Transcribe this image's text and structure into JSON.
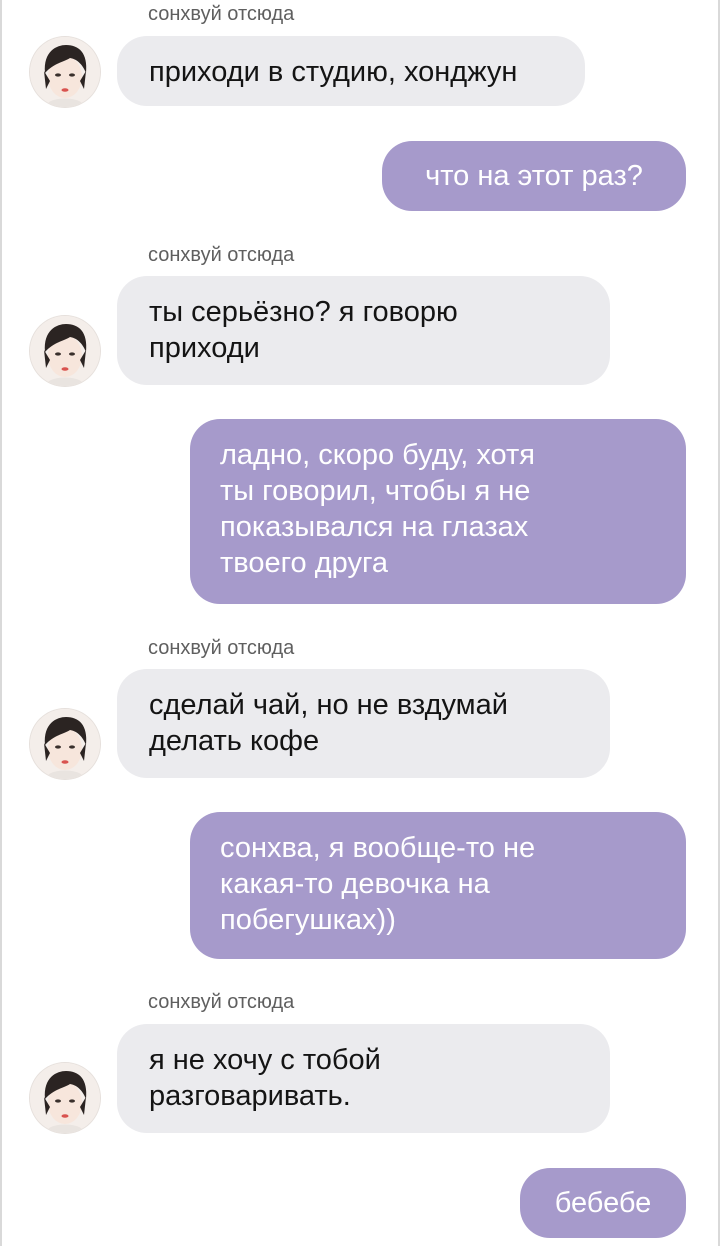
{
  "contact": {
    "name": "сонхвуй отсюда"
  },
  "messages": [
    {
      "direction": "in",
      "sender": "сонхвуй отсюда",
      "text": "приходи в студию, хонджун"
    },
    {
      "direction": "out",
      "text": "что на этот раз?"
    },
    {
      "direction": "in",
      "sender": "сонхвуй отсюда",
      "text": "ты серьёзно? я говорю\nприходи"
    },
    {
      "direction": "out",
      "text": "ладно, скоро буду, хотя\nты говорил, чтобы я не\nпоказывался на глазах\nтвоего друга"
    },
    {
      "direction": "in",
      "sender": "сонхвуй отсюда",
      "text": "сделай чай, но не вздумай\nделать кофе"
    },
    {
      "direction": "out",
      "text": "сонхва, я вообще-то не\nкакая-то девочка на\nпобегушках))"
    },
    {
      "direction": "in",
      "sender": "сонхвуй отсюда",
      "text": "я не хочу с тобой\nразговаривать."
    },
    {
      "direction": "out",
      "text": "бебебе"
    }
  ],
  "colors": {
    "incoming_bubble": "#ebebee",
    "outgoing_bubble": "#a69acb",
    "outgoing_text": "#ffffff",
    "sender_label": "#5f5f5f"
  },
  "icons": {
    "avatar": "contact-avatar-photo"
  }
}
